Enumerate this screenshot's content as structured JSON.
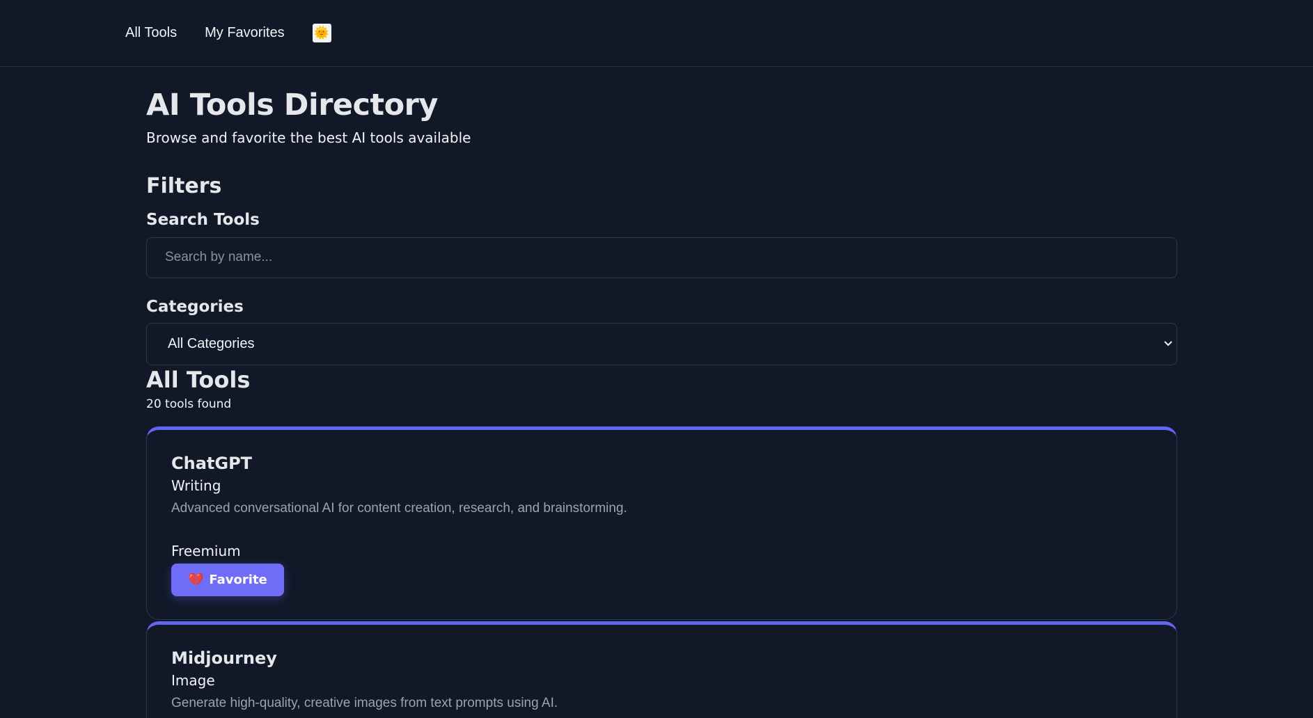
{
  "nav": {
    "all_tools": "All Tools",
    "my_favorites": "My Favorites",
    "theme_icon": "🌞"
  },
  "header": {
    "title": "AI Tools Directory",
    "subtitle": "Browse and favorite the best AI tools available"
  },
  "filters": {
    "heading": "Filters",
    "search_label": "Search Tools",
    "search_placeholder": "Search by name...",
    "search_value": "",
    "categories_label": "Categories",
    "category_selected": "All Categories"
  },
  "results": {
    "heading": "All Tools",
    "count_text": "20 tools found"
  },
  "tools": [
    {
      "name": "ChatGPT",
      "category": "Writing",
      "description": "Advanced conversational AI for content creation, research, and brainstorming.",
      "pricing": "Freemium",
      "favorite_label": "Favorite",
      "favorite_icon": "💔"
    },
    {
      "name": "Midjourney",
      "category": "Image",
      "description": "Generate high-quality, creative images from text prompts using AI."
    }
  ],
  "colors": {
    "background": "#111827",
    "accent": "#6366f1",
    "button": "#6f6cf7",
    "muted_text": "#9ca3af",
    "border": "#2f3848"
  }
}
